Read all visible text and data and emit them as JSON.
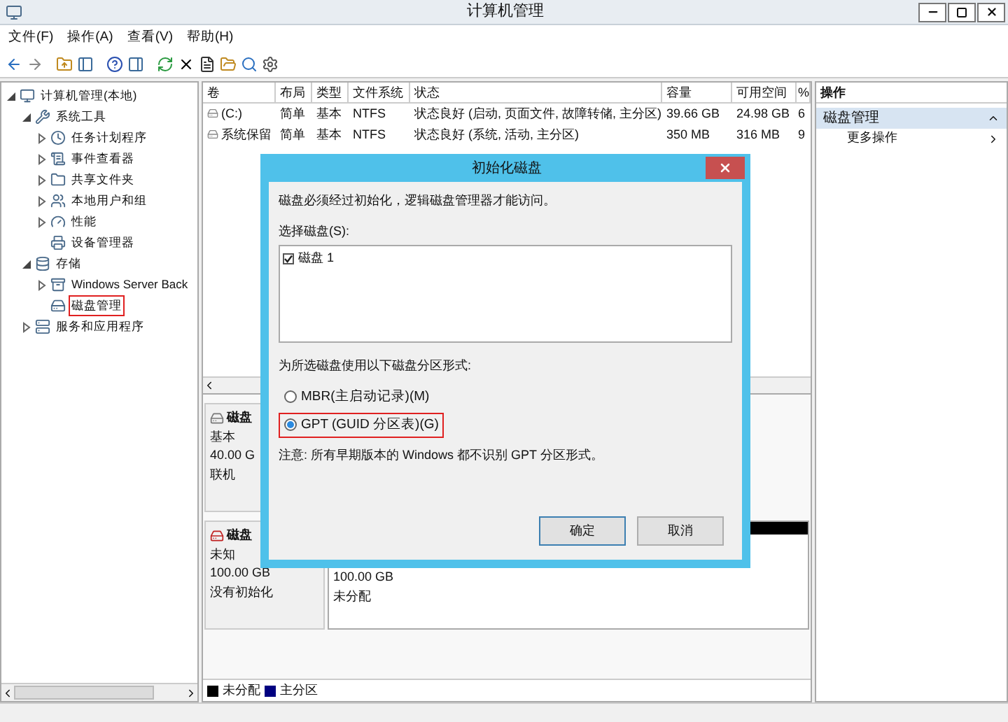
{
  "window": {
    "title": "计算机管理"
  },
  "menu": [
    "文件(F)",
    "操作(A)",
    "查看(V)",
    "帮助(H)"
  ],
  "tree": [
    {
      "label": "计算机管理(本地)",
      "expanded": true,
      "selected": false,
      "children": [
        {
          "label": "系统工具",
          "expanded": true,
          "selected": false,
          "children": [
            {
              "label": "任务计划程序",
              "expanded": false,
              "selected": false
            },
            {
              "label": "事件查看器",
              "expanded": false,
              "selected": false
            },
            {
              "label": "共享文件夹",
              "expanded": false,
              "selected": false
            },
            {
              "label": "本地用户和组",
              "expanded": false,
              "selected": false
            },
            {
              "label": "性能",
              "expanded": false,
              "selected": false
            },
            {
              "label": "设备管理器",
              "selected": false
            }
          ]
        },
        {
          "label": "存储",
          "expanded": true,
          "selected": false,
          "children": [
            {
              "label": "Windows Server Back",
              "expanded": false,
              "selected": false
            },
            {
              "label": "磁盘管理",
              "selected": true
            }
          ]
        },
        {
          "label": "服务和应用程序",
          "expanded": false,
          "selected": false
        }
      ]
    }
  ],
  "table": {
    "columns": [
      "卷",
      "布局",
      "类型",
      "文件系统",
      "状态",
      "容量",
      "可用空间",
      "%"
    ],
    "rows": [
      [
        "(C:)",
        "简单",
        "基本",
        "NTFS",
        "状态良好 (启动, 页面文件, 故障转储, 主分区)",
        "39.66 GB",
        "24.98 GB",
        "6"
      ],
      [
        "系统保留",
        "简单",
        "基本",
        "NTFS",
        "状态良好 (系统, 活动, 主分区)",
        "350 MB",
        "316 MB",
        "9"
      ]
    ]
  },
  "disks": [
    {
      "kind": "online",
      "name": "磁盘",
      "type": "基本",
      "size": "40.00 G",
      "status": "联机"
    },
    {
      "kind": "unknown",
      "name": "磁盘",
      "type": "未知",
      "size": "100.00 GB",
      "status": "没有初始化",
      "partitions": [
        {
          "size": "100.00 GB",
          "label": "未分配",
          "color": "#000000"
        }
      ]
    }
  ],
  "legend": [
    {
      "label": "未分配",
      "color": "#000000"
    },
    {
      "label": "主分区",
      "color": "#000080"
    }
  ],
  "actions": {
    "header": "操作",
    "section": "磁盘管理",
    "items": [
      "更多操作"
    ]
  },
  "dialog": {
    "title": "初始化磁盘",
    "message": "磁盘必须经过初始化，逻辑磁盘管理器才能访问。",
    "list_label": "选择磁盘(S):",
    "disks": [
      {
        "label": "磁盘 1",
        "checked": true
      }
    ],
    "style_label": "为所选磁盘使用以下磁盘分区形式:",
    "options": [
      {
        "label": "MBR(主启动记录)(M)",
        "selected": false
      },
      {
        "label": "GPT (GUID 分区表)(G)",
        "selected": true
      }
    ],
    "note": "注意: 所有早期版本的 Windows 都不识别 GPT 分区形式。",
    "buttons": [
      "确定",
      "取消"
    ]
  }
}
